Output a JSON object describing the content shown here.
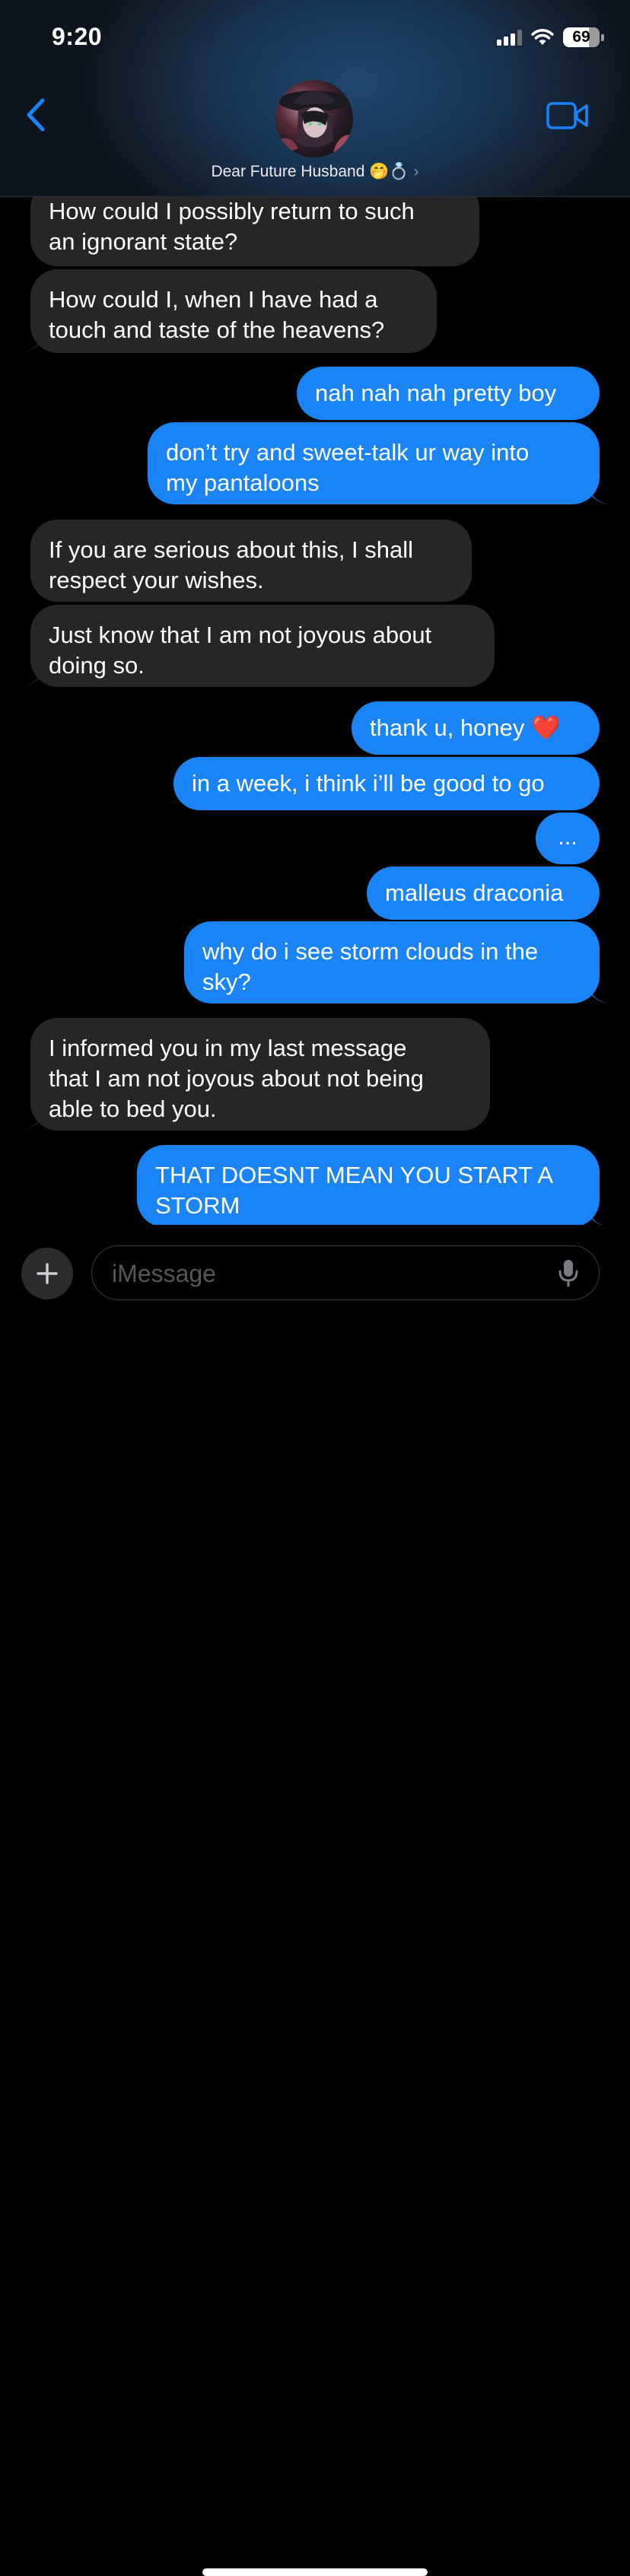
{
  "status_bar": {
    "time": "9:20",
    "battery": "69",
    "signal_icon": "cellular-signal-icon",
    "wifi_icon": "wifi-icon"
  },
  "header": {
    "contact_name": "Dear Future Husband 🤭💍",
    "chevron": "›",
    "back_icon": "chevron-left-icon",
    "video_icon": "video-camera-icon",
    "accent": "#1a84f6"
  },
  "messages": [
    {
      "from": "them",
      "text": "How could I possibly return to such\nan ignorant state?"
    },
    {
      "from": "them",
      "text": "How could I, when I have had a\ntouch and taste of the heavens?"
    },
    {
      "from": "me",
      "text": "nah nah nah pretty boy"
    },
    {
      "from": "me",
      "text": "don’t try and sweet-talk ur way into\nmy pantaloons"
    },
    {
      "from": "them",
      "text": "If you are serious about this, I shall\nrespect your wishes."
    },
    {
      "from": "them",
      "text": "Just know that I am not joyous about\ndoing so."
    },
    {
      "from": "me",
      "text": "thank u, honey ❤️"
    },
    {
      "from": "me",
      "text": "in a week, i think i’ll be good to go"
    },
    {
      "from": "me",
      "text": "..."
    },
    {
      "from": "me",
      "text": "malleus draconia"
    },
    {
      "from": "me",
      "text": "why do i see storm clouds in the\nsky?"
    },
    {
      "from": "them",
      "text": "I informed you in my last message\nthat I am not joyous about not being\nable to bed you."
    },
    {
      "from": "me",
      "text": "THAT DOESNT MEAN YOU START A\nSTORM"
    }
  ],
  "composer": {
    "placeholder": "iMessage",
    "plus_icon": "plus-icon",
    "mic_icon": "microphone-icon"
  },
  "colors": {
    "outgoing_bubble": "#1a84f6",
    "incoming_bubble": "#262628",
    "background": "#000000"
  }
}
